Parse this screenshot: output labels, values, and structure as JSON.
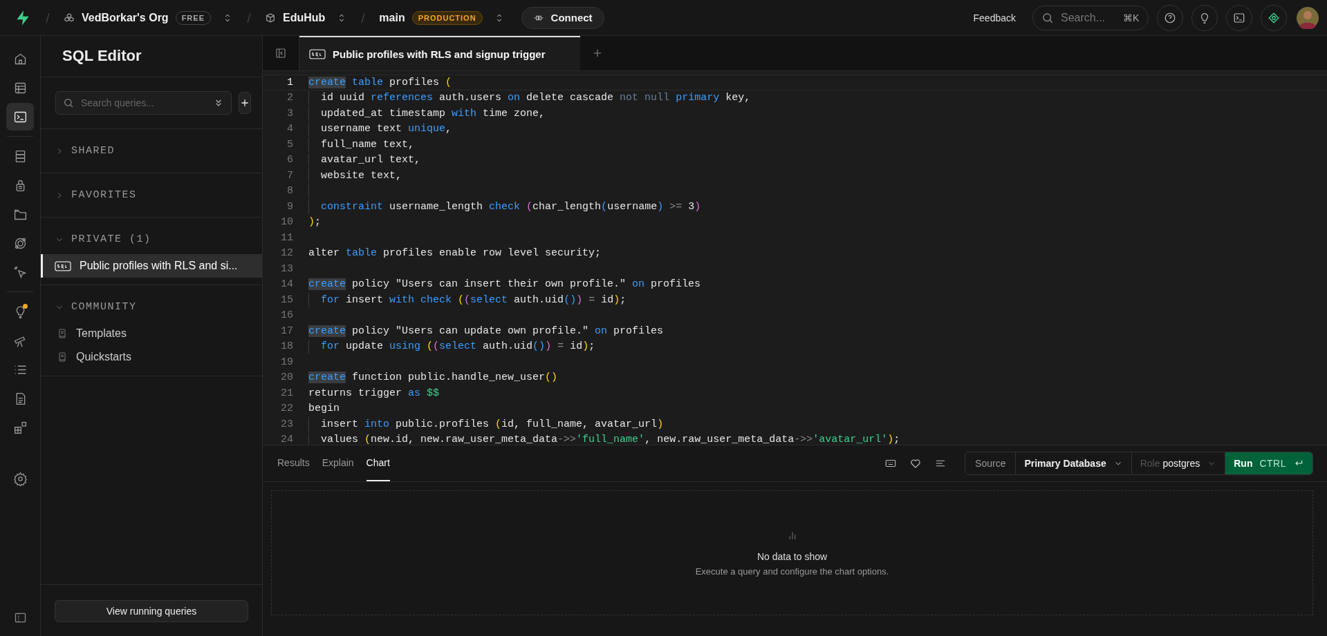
{
  "topbar": {
    "org": {
      "name": "VedBorkar's Org",
      "plan": "FREE"
    },
    "project": {
      "name": "EduHub"
    },
    "branch": {
      "name": "main",
      "env": "PRODUCTION"
    },
    "connect": "Connect",
    "feedback": "Feedback",
    "search": {
      "placeholder": "Search...",
      "shortcut": "⌘K"
    }
  },
  "rail": [
    {
      "selected": false,
      "badge": false
    },
    {
      "selected": false,
      "badge": false
    },
    {
      "selected": true,
      "badge": false
    },
    {
      "selected": false,
      "badge": false
    },
    {
      "selected": false,
      "badge": false
    },
    {
      "selected": false,
      "badge": false
    },
    {
      "selected": false,
      "badge": false
    },
    {
      "selected": false,
      "badge": false
    },
    {
      "selected": false,
      "badge": true
    },
    {
      "selected": false,
      "badge": false
    },
    {
      "selected": false,
      "badge": false
    },
    {
      "selected": false,
      "badge": false
    },
    {
      "selected": false,
      "badge": false
    },
    {
      "selected": false,
      "badge": false
    }
  ],
  "sidebar": {
    "title": "SQL Editor",
    "search": {
      "placeholder": "Search queries..."
    },
    "sections": [
      {
        "label": "SHARED",
        "expanded": false
      },
      {
        "label": "FAVORITES",
        "expanded": false
      },
      {
        "label": "PRIVATE (1)",
        "expanded": true,
        "items": [
          {
            "kind": "sql",
            "label": "Public profiles with RLS and si...",
            "selected": true
          }
        ]
      },
      {
        "label": "COMMUNITY",
        "expanded": true,
        "items": [
          {
            "kind": "book",
            "label": "Templates",
            "selected": false
          },
          {
            "kind": "book",
            "label": "Quickstarts",
            "selected": false
          }
        ]
      }
    ],
    "footer_button": "View running queries"
  },
  "editor": {
    "tabs": [
      {
        "label": "Public profiles with RLS and signup trigger",
        "selected": true
      }
    ],
    "lines": [
      {
        "number": "1",
        "current": true,
        "guide": false,
        "tokens": [
          {
            "kind": "match",
            "text": "create"
          },
          {
            "kind": "kw",
            "text": " table"
          },
          {
            "kind": "plain",
            "text": " profiles "
          },
          {
            "kind": "br1",
            "text": "("
          }
        ]
      },
      {
        "number": "2",
        "current": false,
        "guide": true,
        "tokens": [
          {
            "kind": "plain",
            "text": "id uuid "
          },
          {
            "kind": "kw",
            "text": "references"
          },
          {
            "kind": "plain",
            "text": " auth.users "
          },
          {
            "kind": "kw",
            "text": "on"
          },
          {
            "kind": "plain",
            "text": " delete cascade "
          },
          {
            "kind": "dim",
            "text": "not null"
          },
          {
            "kind": "kw",
            "text": " primary"
          },
          {
            "kind": "plain",
            "text": " key,"
          }
        ]
      },
      {
        "number": "3",
        "current": false,
        "guide": true,
        "tokens": [
          {
            "kind": "plain",
            "text": "updated_at timestamp "
          },
          {
            "kind": "kw",
            "text": "with"
          },
          {
            "kind": "plain",
            "text": " time zone,"
          }
        ]
      },
      {
        "number": "4",
        "current": false,
        "guide": true,
        "tokens": [
          {
            "kind": "plain",
            "text": "username text "
          },
          {
            "kind": "kw",
            "text": "unique"
          },
          {
            "kind": "plain",
            "text": ","
          }
        ]
      },
      {
        "number": "5",
        "current": false,
        "guide": true,
        "tokens": [
          {
            "kind": "plain",
            "text": "full_name text,"
          }
        ]
      },
      {
        "number": "6",
        "current": false,
        "guide": true,
        "tokens": [
          {
            "kind": "plain",
            "text": "avatar_url text,"
          }
        ]
      },
      {
        "number": "7",
        "current": false,
        "guide": true,
        "tokens": [
          {
            "kind": "plain",
            "text": "website text,"
          }
        ]
      },
      {
        "number": "8",
        "current": false,
        "guide": true
      },
      {
        "number": "9",
        "current": false,
        "guide": true,
        "tokens": [
          {
            "kind": "kw",
            "text": "constraint"
          },
          {
            "kind": "plain",
            "text": " username_length "
          },
          {
            "kind": "kw",
            "text": "check"
          },
          {
            "kind": "br2",
            "text": " ("
          },
          {
            "kind": "plain",
            "text": "char_length"
          },
          {
            "kind": "br3",
            "text": "("
          },
          {
            "kind": "plain",
            "text": "username"
          },
          {
            "kind": "br3",
            "text": ")"
          },
          {
            "kind": "op",
            "text": " >="
          },
          {
            "kind": "plain",
            "text": " 3"
          },
          {
            "kind": "br2",
            "text": ")"
          }
        ]
      },
      {
        "number": "10",
        "current": false,
        "guide": false,
        "tokens": [
          {
            "kind": "br1",
            "text": ")"
          },
          {
            "kind": "plain",
            "text": ";"
          }
        ]
      },
      {
        "number": "11",
        "current": false,
        "guide": false
      },
      {
        "number": "12",
        "current": false,
        "guide": false,
        "tokens": [
          {
            "kind": "plain",
            "text": "alter "
          },
          {
            "kind": "kw",
            "text": "table"
          },
          {
            "kind": "plain",
            "text": " profiles enable row level security;"
          }
        ]
      },
      {
        "number": "13",
        "current": false,
        "guide": false
      },
      {
        "number": "14",
        "current": false,
        "guide": false,
        "tokens": [
          {
            "kind": "match",
            "text": "create"
          },
          {
            "kind": "plain",
            "text": " policy \"Users can insert their own profile.\" "
          },
          {
            "kind": "kw",
            "text": "on"
          },
          {
            "kind": "plain",
            "text": " profiles"
          }
        ]
      },
      {
        "number": "15",
        "current": false,
        "guide": true,
        "tokens": [
          {
            "kind": "kw",
            "text": "for"
          },
          {
            "kind": "plain",
            "text": " insert "
          },
          {
            "kind": "kw",
            "text": "with"
          },
          {
            "kind": "kw",
            "text": " check"
          },
          {
            "kind": "br1",
            "text": " ("
          },
          {
            "kind": "br2",
            "text": "("
          },
          {
            "kind": "kw",
            "text": "select"
          },
          {
            "kind": "plain",
            "text": " auth.uid"
          },
          {
            "kind": "br3",
            "text": "()"
          },
          {
            "kind": "br2",
            "text": ")"
          },
          {
            "kind": "op",
            "text": " ="
          },
          {
            "kind": "plain",
            "text": " id"
          },
          {
            "kind": "br1",
            "text": ")"
          },
          {
            "kind": "plain",
            "text": ";"
          }
        ]
      },
      {
        "number": "16",
        "current": false,
        "guide": false
      },
      {
        "number": "17",
        "current": false,
        "guide": false,
        "tokens": [
          {
            "kind": "match",
            "text": "create"
          },
          {
            "kind": "plain",
            "text": " policy \"Users can update own profile.\" "
          },
          {
            "kind": "kw",
            "text": "on"
          },
          {
            "kind": "plain",
            "text": " profiles"
          }
        ]
      },
      {
        "number": "18",
        "current": false,
        "guide": true,
        "tokens": [
          {
            "kind": "kw",
            "text": "for"
          },
          {
            "kind": "plain",
            "text": " update "
          },
          {
            "kind": "kw",
            "text": "using"
          },
          {
            "kind": "br1",
            "text": " ("
          },
          {
            "kind": "br2",
            "text": "("
          },
          {
            "kind": "kw",
            "text": "select"
          },
          {
            "kind": "plain",
            "text": " auth.uid"
          },
          {
            "kind": "br3",
            "text": "()"
          },
          {
            "kind": "br2",
            "text": ")"
          },
          {
            "kind": "op",
            "text": " ="
          },
          {
            "kind": "plain",
            "text": " id"
          },
          {
            "kind": "br1",
            "text": ")"
          },
          {
            "kind": "plain",
            "text": ";"
          }
        ]
      },
      {
        "number": "19",
        "current": false,
        "guide": false
      },
      {
        "number": "20",
        "current": false,
        "guide": false,
        "tokens": [
          {
            "kind": "match",
            "text": "create"
          },
          {
            "kind": "plain",
            "text": " function public.handle_new_user"
          },
          {
            "kind": "br1",
            "text": "()"
          }
        ]
      },
      {
        "number": "21",
        "current": false,
        "guide": false,
        "tokens": [
          {
            "kind": "plain",
            "text": "returns trigger "
          },
          {
            "kind": "kw",
            "text": "as"
          },
          {
            "kind": "str",
            "text": " $$"
          }
        ]
      },
      {
        "number": "22",
        "current": false,
        "guide": false,
        "tokens": [
          {
            "kind": "plain",
            "text": "begin"
          }
        ]
      },
      {
        "number": "23",
        "current": false,
        "guide": true,
        "tokens": [
          {
            "kind": "plain",
            "text": "insert "
          },
          {
            "kind": "kw",
            "text": "into"
          },
          {
            "kind": "plain",
            "text": " public.profiles "
          },
          {
            "kind": "br1",
            "text": "("
          },
          {
            "kind": "plain",
            "text": "id, full_name, avatar_url"
          },
          {
            "kind": "br1",
            "text": ")"
          }
        ]
      },
      {
        "number": "24",
        "current": false,
        "guide": true,
        "tokens": [
          {
            "kind": "plain",
            "text": "values "
          },
          {
            "kind": "br1",
            "text": "("
          },
          {
            "kind": "plain",
            "text": "new.id, new.raw_user_meta_data"
          },
          {
            "kind": "op",
            "text": "->>"
          },
          {
            "kind": "str",
            "text": "'full_name'"
          },
          {
            "kind": "plain",
            "text": ", new.raw_user_meta_data"
          },
          {
            "kind": "op",
            "text": "->>"
          },
          {
            "kind": "str",
            "text": "'avatar_url'"
          },
          {
            "kind": "br1",
            "text": ")"
          },
          {
            "kind": "plain",
            "text": ";"
          }
        ]
      }
    ]
  },
  "results": {
    "tabs": [
      {
        "label": "Results",
        "selected": false
      },
      {
        "label": "Explain",
        "selected": false
      },
      {
        "label": "Chart",
        "selected": true
      }
    ],
    "source_label": "Source",
    "source": "Primary Database",
    "role_label": "Role",
    "role": "postgres",
    "run": "Run",
    "run_shortcut": "CTRL",
    "empty": {
      "title": "No data to show",
      "message": "Execute a query and configure the chart options."
    }
  }
}
